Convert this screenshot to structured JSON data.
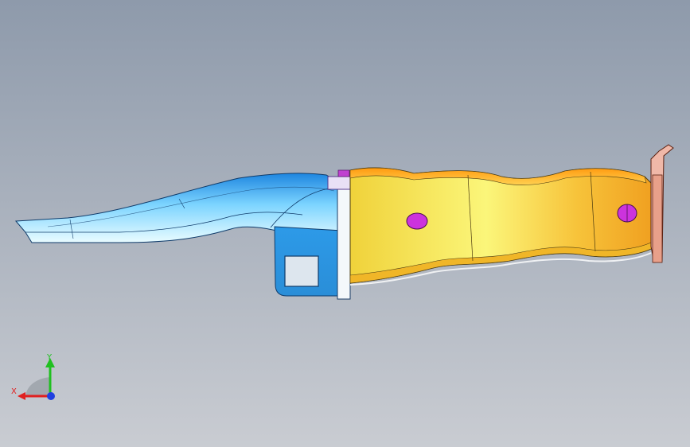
{
  "viewport": {
    "background_top": "#8e9aab",
    "background_bottom": "#c7cbd1"
  },
  "model": {
    "parts": [
      {
        "name": "front-rail-extension",
        "color": "#2f9ee8"
      },
      {
        "name": "front-bracket",
        "color": "#3aa7f0"
      },
      {
        "name": "main-side-member",
        "color": "#f2d23a"
      },
      {
        "name": "end-flange",
        "color": "#e8a08a"
      },
      {
        "name": "hole-marker",
        "color": "#cc33dd"
      }
    ]
  },
  "triad": {
    "x_label": "X",
    "y_label": "Y",
    "x_color": "#e02020",
    "y_color": "#20c020",
    "z_color": "#2040e0"
  }
}
